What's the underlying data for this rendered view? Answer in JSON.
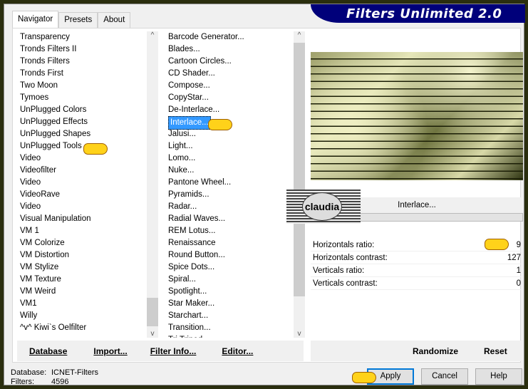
{
  "title": "Filters Unlimited 2.0",
  "tabs": [
    "Navigator",
    "Presets",
    "About"
  ],
  "categories": [
    "Transparency",
    "Tronds Filters II",
    "Tronds Filters",
    "Tronds First",
    "Two Moon",
    "Tymoes",
    "UnPlugged Colors",
    "UnPlugged Effects",
    "UnPlugged Shapes",
    "UnPlugged Tools",
    "Video",
    "Videofilter",
    "Video",
    "VideoRave",
    "Video",
    "Visual Manipulation",
    "VM 1",
    "VM Colorize",
    "VM Distortion",
    "VM Stylize",
    "VM Texture",
    "VM Weird",
    "VM1",
    "Willy",
    "^v^ Kiwi`s Oelfilter"
  ],
  "selected_category": "UnPlugged Tools",
  "filters": [
    "Barcode Generator...",
    "Blades...",
    "Cartoon Circles...",
    "CD Shader...",
    "Compose...",
    "CopyStar...",
    "De-Interlace...",
    "Interlace...",
    "Jalusi...",
    "Light...",
    "Lomo...",
    "Nuke...",
    "Pantone Wheel...",
    "Pyramids...",
    "Radar...",
    "Radial Waves...",
    "REM Lotus...",
    "Renaissance",
    "Round Button...",
    "Spice Dots...",
    "Spiral...",
    "Spotlight...",
    "Star Maker...",
    "Starchart...",
    "Transition...",
    "Tri Tripod..."
  ],
  "selected_filter": "Interlace...",
  "filter_name": "Interlace...",
  "params": [
    {
      "label": "Horizontals ratio:",
      "value": "9"
    },
    {
      "label": "Horizontals contrast:",
      "value": "127"
    },
    {
      "label": "Verticals ratio:",
      "value": "1"
    },
    {
      "label": "Verticals contrast:",
      "value": "0"
    }
  ],
  "left_buttons": [
    "Database",
    "Import...",
    "Filter Info...",
    "Editor..."
  ],
  "right_buttons": [
    "Randomize",
    "Reset"
  ],
  "status": {
    "db_label": "Database:",
    "db_value": "ICNET-Filters",
    "filters_label": "Filters:",
    "filters_value": "4596"
  },
  "dialog_buttons": {
    "apply": "Apply",
    "cancel": "Cancel",
    "help": "Help"
  },
  "watermark": "claudia"
}
